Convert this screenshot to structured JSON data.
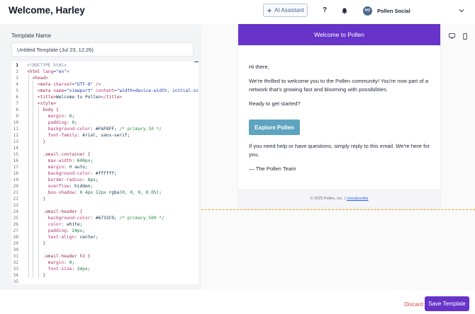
{
  "header": {
    "welcome": "Welcome, Harley",
    "ai_assistant": "AI Assistant",
    "help": "?",
    "account_initials": "HO",
    "account_name": "Pollen Social"
  },
  "editor": {
    "template_name_label": "Template Name",
    "template_name_value": "Untitled Template (Jul 23, 12:26)",
    "lines": [
      [
        {
          "t": "<!DOCTYPE html>",
          "c": "c"
        }
      ],
      [
        {
          "t": "<html ",
          "c": "t"
        },
        {
          "t": "lang",
          "c": "a"
        },
        {
          "t": "=",
          "c": "v"
        },
        {
          "t": "\"en\"",
          "c": "s"
        },
        {
          "t": ">",
          "c": "t"
        }
      ],
      [
        {
          "t": "  <head>",
          "c": "t"
        }
      ],
      [
        {
          "t": "    <meta ",
          "c": "t"
        },
        {
          "t": "charset",
          "c": "a"
        },
        {
          "t": "=",
          "c": "v"
        },
        {
          "t": "\"UTF-8\"",
          "c": "s"
        },
        {
          "t": " />",
          "c": "t"
        }
      ],
      [
        {
          "t": "    <meta ",
          "c": "t"
        },
        {
          "t": "name",
          "c": "a"
        },
        {
          "t": "=",
          "c": "v"
        },
        {
          "t": "\"viewport\"",
          "c": "s"
        },
        {
          "t": " ",
          "c": "v"
        },
        {
          "t": "content",
          "c": "a"
        },
        {
          "t": "=",
          "c": "v"
        },
        {
          "t": "\"width=device-width, initial-sca",
          "c": "s"
        }
      ],
      [
        {
          "t": "    <title>",
          "c": "t"
        },
        {
          "t": "Welcome to Pollen",
          "c": "v"
        },
        {
          "t": "</title>",
          "c": "t"
        }
      ],
      [
        {
          "t": "    <style>",
          "c": "t"
        }
      ],
      [
        {
          "t": "      body {",
          "c": "t"
        }
      ],
      [
        {
          "t": "        margin",
          "c": "p"
        },
        {
          "t": ": ",
          "c": "v"
        },
        {
          "t": "0",
          "c": "n"
        },
        {
          "t": ";",
          "c": "v"
        }
      ],
      [
        {
          "t": "        padding",
          "c": "p"
        },
        {
          "t": ": ",
          "c": "v"
        },
        {
          "t": "0",
          "c": "n"
        },
        {
          "t": ";",
          "c": "v"
        }
      ],
      [
        {
          "t": "        background-color",
          "c": "p"
        },
        {
          "t": ": #FAF8FF; ",
          "c": "v"
        },
        {
          "t": "/* primary.10 */",
          "c": "g"
        }
      ],
      [
        {
          "t": "        font-family",
          "c": "p"
        },
        {
          "t": ": Arial, sans-serif;",
          "c": "v"
        }
      ],
      [
        {
          "t": "      }",
          "c": "t"
        }
      ],
      [
        {
          "t": "",
          "c": "v"
        }
      ],
      [
        {
          "t": "      .email-container {",
          "c": "t"
        }
      ],
      [
        {
          "t": "        max-width",
          "c": "p"
        },
        {
          "t": ": ",
          "c": "v"
        },
        {
          "t": "600px",
          "c": "n"
        },
        {
          "t": ";",
          "c": "v"
        }
      ],
      [
        {
          "t": "        margin",
          "c": "p"
        },
        {
          "t": ": ",
          "c": "v"
        },
        {
          "t": "0",
          "c": "n"
        },
        {
          "t": " auto;",
          "c": "v"
        }
      ],
      [
        {
          "t": "        background-color",
          "c": "p"
        },
        {
          "t": ": #ffffff;",
          "c": "v"
        }
      ],
      [
        {
          "t": "        border-radius",
          "c": "p"
        },
        {
          "t": ": ",
          "c": "v"
        },
        {
          "t": "8px",
          "c": "n"
        },
        {
          "t": ";",
          "c": "v"
        }
      ],
      [
        {
          "t": "        overflow",
          "c": "p"
        },
        {
          "t": ": hidden;",
          "c": "v"
        }
      ],
      [
        {
          "t": "        box-shadow",
          "c": "p"
        },
        {
          "t": ": ",
          "c": "v"
        },
        {
          "t": "0 4px 12px",
          "c": "n"
        },
        {
          "t": " rgba(",
          "c": "v"
        },
        {
          "t": "0, 0, 0, 0.05",
          "c": "n"
        },
        {
          "t": ");",
          "c": "v"
        }
      ],
      [
        {
          "t": "      }",
          "c": "t"
        }
      ],
      [
        {
          "t": "",
          "c": "v"
        }
      ],
      [
        {
          "t": "      .email-header {",
          "c": "t"
        }
      ],
      [
        {
          "t": "        background-color",
          "c": "p"
        },
        {
          "t": ": #6733C9; ",
          "c": "v"
        },
        {
          "t": "/* primary.500 */",
          "c": "g"
        }
      ],
      [
        {
          "t": "        color",
          "c": "p"
        },
        {
          "t": ": white;",
          "c": "v"
        }
      ],
      [
        {
          "t": "        padding",
          "c": "p"
        },
        {
          "t": ": ",
          "c": "v"
        },
        {
          "t": "24px",
          "c": "n"
        },
        {
          "t": ";",
          "c": "v"
        }
      ],
      [
        {
          "t": "        text-align",
          "c": "p"
        },
        {
          "t": ": center;",
          "c": "v"
        }
      ],
      [
        {
          "t": "      }",
          "c": "t"
        }
      ],
      [
        {
          "t": "",
          "c": "v"
        }
      ],
      [
        {
          "t": "      .email-header h1 {",
          "c": "t"
        }
      ],
      [
        {
          "t": "        margin",
          "c": "p"
        },
        {
          "t": ": ",
          "c": "v"
        },
        {
          "t": "0",
          "c": "n"
        },
        {
          "t": ";",
          "c": "v"
        }
      ],
      [
        {
          "t": "        font-size",
          "c": "p"
        },
        {
          "t": ": ",
          "c": "v"
        },
        {
          "t": "24px",
          "c": "n"
        },
        {
          "t": ";",
          "c": "v"
        }
      ],
      [
        {
          "t": "      }",
          "c": "t"
        }
      ],
      [
        {
          "t": "",
          "c": "v"
        }
      ]
    ]
  },
  "preview": {
    "header_title": "Welcome to Pollen",
    "greeting": "Hi there,",
    "intro": "We're thrilled to welcome you to the Pollen community! You're now part of a network that's growing fast and blooming with possibilities.",
    "cta_prompt": "Ready to get started?",
    "cta_button": "Explore Pollen",
    "help_text": "If you need help or have questions, simply reply to this email. We're here for you.",
    "signoff": "— The Pollen Team",
    "footer_text": "© 2025 Pollen, Inc. |",
    "footer_link": "Unsubscribe"
  },
  "actions": {
    "discard": "Discard",
    "save": "Save Template"
  },
  "colors": {
    "primary": "#6733c9",
    "cta": "#5ea3c0",
    "discard": "#dc4a4a",
    "divider": "#f59e0b"
  }
}
